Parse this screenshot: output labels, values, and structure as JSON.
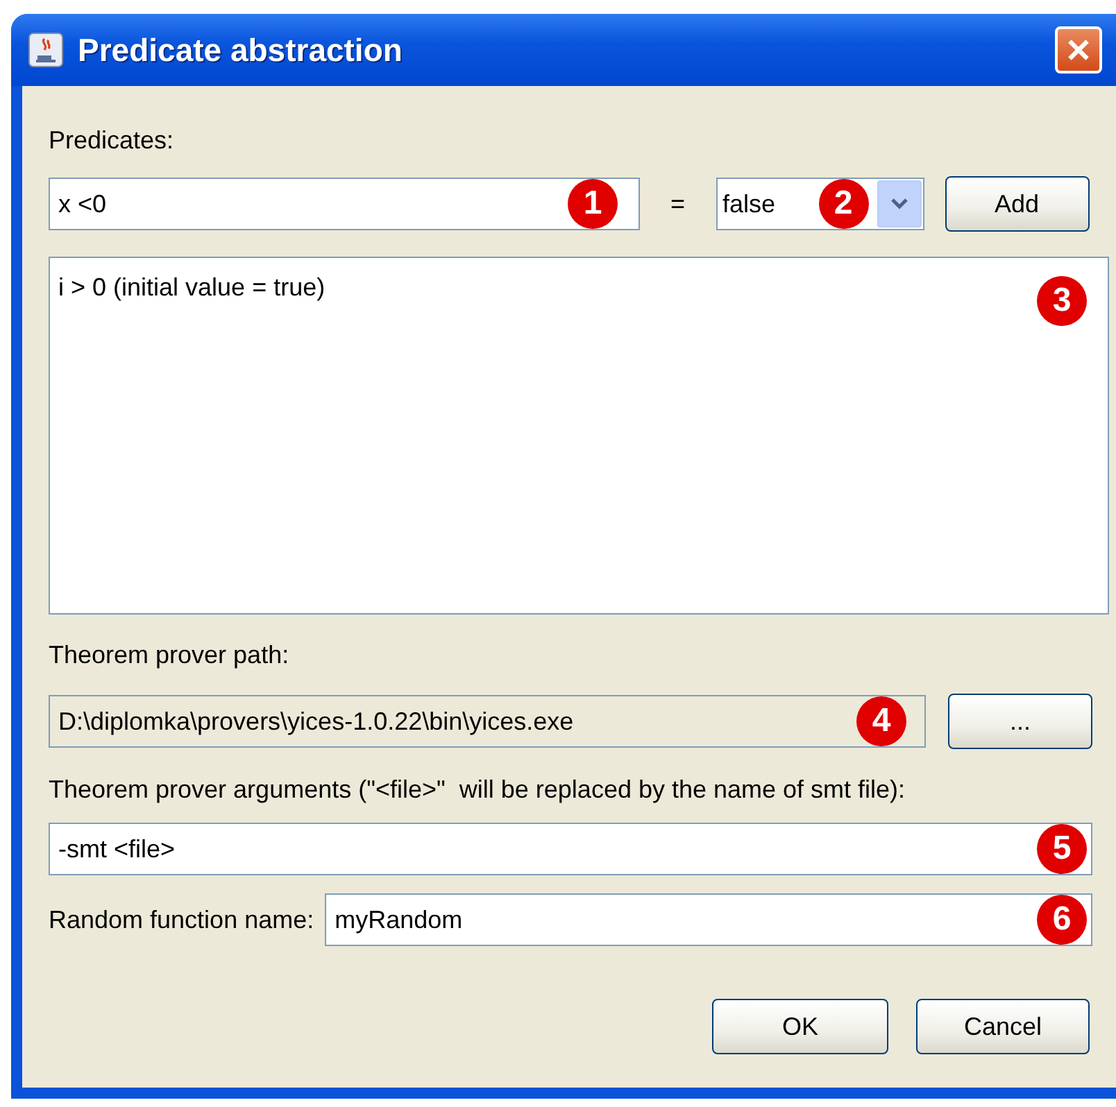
{
  "window": {
    "title": "Predicate abstraction"
  },
  "predicates": {
    "label": "Predicates:",
    "input": {
      "value": "x <0",
      "badge": "1"
    },
    "equals": "=",
    "value_select": {
      "value": "false",
      "badge": "2"
    },
    "add_button": "Add",
    "list": {
      "items": [
        "i > 0 (initial value = true)"
      ],
      "badge": "3"
    }
  },
  "prover_path": {
    "label": "Theorem prover path:",
    "value": "D:\\diplomka\\provers\\yices-1.0.22\\bin\\yices.exe",
    "disabled": true,
    "badge": "4",
    "browse_button": "..."
  },
  "prover_arguments": {
    "label": "Theorem prover arguments (\"<file>\"  will be replaced by the name of smt file):",
    "value": "-smt <file>",
    "disabled": false,
    "badge": "5"
  },
  "random_function": {
    "label": "Random function name:",
    "value": "myRandom",
    "disabled": false,
    "badge": "6"
  },
  "buttons": [
    "OK",
    "Cancel"
  ]
}
